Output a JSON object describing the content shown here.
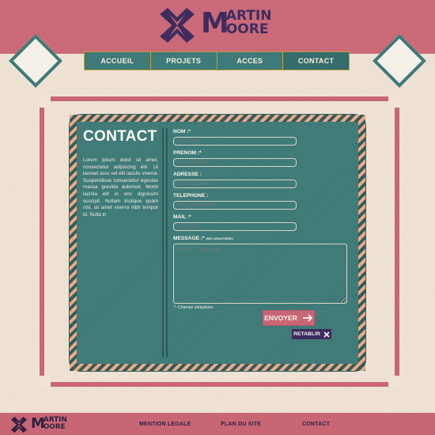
{
  "brand": {
    "logo_m": "M",
    "logo_line1": "ARTIN",
    "logo_line2": "OORE"
  },
  "nav": {
    "items": [
      {
        "label": "ACCUEIL"
      },
      {
        "label": "PROJETS"
      },
      {
        "label": "ACCES"
      },
      {
        "label": "CONTACT",
        "active": true
      }
    ]
  },
  "contact": {
    "title": "CONTACT",
    "intro": "Lorem ipsum dolor sit amet, consectetur adipiscing elit. Ut laoreet arcu vel elit iaculis viverra. Suspendisse consectetur egestas massa gravida aulsmod. Morbi lacinia elit in orci dignissim suscipit. Nullam tristique quam nisl, sit amet viverra nibh tempor id. Nulla in"
  },
  "form": {
    "nom": {
      "label": "NOM :*",
      "placeholder": "Votre  nom"
    },
    "prenom": {
      "label": "PRENOM :*",
      "placeholder": "Votre  prénom"
    },
    "adresse": {
      "label": "ADRESSE :",
      "placeholder": "Votre  adresse"
    },
    "telephone": {
      "label": "TELEPHONE :",
      "placeholder": "Votre  téléphone"
    },
    "mail": {
      "label": "MAIL :*",
      "placeholder": "Votre  mail"
    },
    "message": {
      "label": "MESSAGE :*",
      "note": "(500 CARACTERES)",
      "placeholder": "Votre  message"
    },
    "required_note": "*: Champs obligatoire",
    "send_label": "ENVOYER",
    "reset_label": "RETABLIR"
  },
  "footer": {
    "links": [
      "MENTION LEGALE",
      "PLAN DU SITE",
      "CONTACT"
    ]
  },
  "colors": {
    "teal": "#3e7a77",
    "rose": "#c96676",
    "plum": "#3f2c5e",
    "cream": "#f1e4d6",
    "gold": "#c79a3e"
  }
}
